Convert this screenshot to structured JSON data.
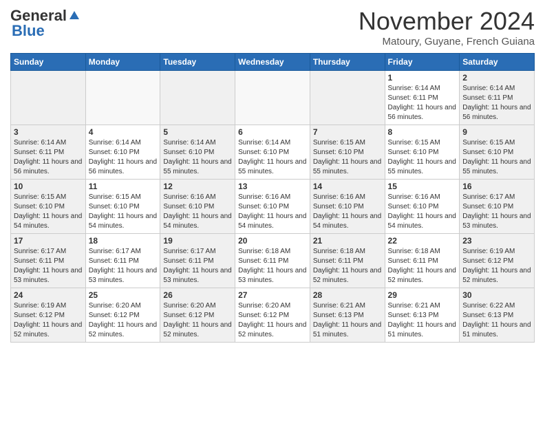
{
  "header": {
    "logo_general": "General",
    "logo_blue": "Blue",
    "month": "November 2024",
    "location": "Matoury, Guyane, French Guiana"
  },
  "weekdays": [
    "Sunday",
    "Monday",
    "Tuesday",
    "Wednesday",
    "Thursday",
    "Friday",
    "Saturday"
  ],
  "weeks": [
    [
      {
        "day": "",
        "info": ""
      },
      {
        "day": "",
        "info": ""
      },
      {
        "day": "",
        "info": ""
      },
      {
        "day": "",
        "info": ""
      },
      {
        "day": "",
        "info": ""
      },
      {
        "day": "1",
        "info": "Sunrise: 6:14 AM\nSunset: 6:11 PM\nDaylight: 11 hours and 56 minutes."
      },
      {
        "day": "2",
        "info": "Sunrise: 6:14 AM\nSunset: 6:11 PM\nDaylight: 11 hours and 56 minutes."
      }
    ],
    [
      {
        "day": "3",
        "info": "Sunrise: 6:14 AM\nSunset: 6:11 PM\nDaylight: 11 hours and 56 minutes."
      },
      {
        "day": "4",
        "info": "Sunrise: 6:14 AM\nSunset: 6:10 PM\nDaylight: 11 hours and 56 minutes."
      },
      {
        "day": "5",
        "info": "Sunrise: 6:14 AM\nSunset: 6:10 PM\nDaylight: 11 hours and 55 minutes."
      },
      {
        "day": "6",
        "info": "Sunrise: 6:14 AM\nSunset: 6:10 PM\nDaylight: 11 hours and 55 minutes."
      },
      {
        "day": "7",
        "info": "Sunrise: 6:15 AM\nSunset: 6:10 PM\nDaylight: 11 hours and 55 minutes."
      },
      {
        "day": "8",
        "info": "Sunrise: 6:15 AM\nSunset: 6:10 PM\nDaylight: 11 hours and 55 minutes."
      },
      {
        "day": "9",
        "info": "Sunrise: 6:15 AM\nSunset: 6:10 PM\nDaylight: 11 hours and 55 minutes."
      }
    ],
    [
      {
        "day": "10",
        "info": "Sunrise: 6:15 AM\nSunset: 6:10 PM\nDaylight: 11 hours and 54 minutes."
      },
      {
        "day": "11",
        "info": "Sunrise: 6:15 AM\nSunset: 6:10 PM\nDaylight: 11 hours and 54 minutes."
      },
      {
        "day": "12",
        "info": "Sunrise: 6:16 AM\nSunset: 6:10 PM\nDaylight: 11 hours and 54 minutes."
      },
      {
        "day": "13",
        "info": "Sunrise: 6:16 AM\nSunset: 6:10 PM\nDaylight: 11 hours and 54 minutes."
      },
      {
        "day": "14",
        "info": "Sunrise: 6:16 AM\nSunset: 6:10 PM\nDaylight: 11 hours and 54 minutes."
      },
      {
        "day": "15",
        "info": "Sunrise: 6:16 AM\nSunset: 6:10 PM\nDaylight: 11 hours and 54 minutes."
      },
      {
        "day": "16",
        "info": "Sunrise: 6:17 AM\nSunset: 6:10 PM\nDaylight: 11 hours and 53 minutes."
      }
    ],
    [
      {
        "day": "17",
        "info": "Sunrise: 6:17 AM\nSunset: 6:11 PM\nDaylight: 11 hours and 53 minutes."
      },
      {
        "day": "18",
        "info": "Sunrise: 6:17 AM\nSunset: 6:11 PM\nDaylight: 11 hours and 53 minutes."
      },
      {
        "day": "19",
        "info": "Sunrise: 6:17 AM\nSunset: 6:11 PM\nDaylight: 11 hours and 53 minutes."
      },
      {
        "day": "20",
        "info": "Sunrise: 6:18 AM\nSunset: 6:11 PM\nDaylight: 11 hours and 53 minutes."
      },
      {
        "day": "21",
        "info": "Sunrise: 6:18 AM\nSunset: 6:11 PM\nDaylight: 11 hours and 52 minutes."
      },
      {
        "day": "22",
        "info": "Sunrise: 6:18 AM\nSunset: 6:11 PM\nDaylight: 11 hours and 52 minutes."
      },
      {
        "day": "23",
        "info": "Sunrise: 6:19 AM\nSunset: 6:12 PM\nDaylight: 11 hours and 52 minutes."
      }
    ],
    [
      {
        "day": "24",
        "info": "Sunrise: 6:19 AM\nSunset: 6:12 PM\nDaylight: 11 hours and 52 minutes."
      },
      {
        "day": "25",
        "info": "Sunrise: 6:20 AM\nSunset: 6:12 PM\nDaylight: 11 hours and 52 minutes."
      },
      {
        "day": "26",
        "info": "Sunrise: 6:20 AM\nSunset: 6:12 PM\nDaylight: 11 hours and 52 minutes."
      },
      {
        "day": "27",
        "info": "Sunrise: 6:20 AM\nSunset: 6:12 PM\nDaylight: 11 hours and 52 minutes."
      },
      {
        "day": "28",
        "info": "Sunrise: 6:21 AM\nSunset: 6:13 PM\nDaylight: 11 hours and 51 minutes."
      },
      {
        "day": "29",
        "info": "Sunrise: 6:21 AM\nSunset: 6:13 PM\nDaylight: 11 hours and 51 minutes."
      },
      {
        "day": "30",
        "info": "Sunrise: 6:22 AM\nSunset: 6:13 PM\nDaylight: 11 hours and 51 minutes."
      }
    ]
  ]
}
